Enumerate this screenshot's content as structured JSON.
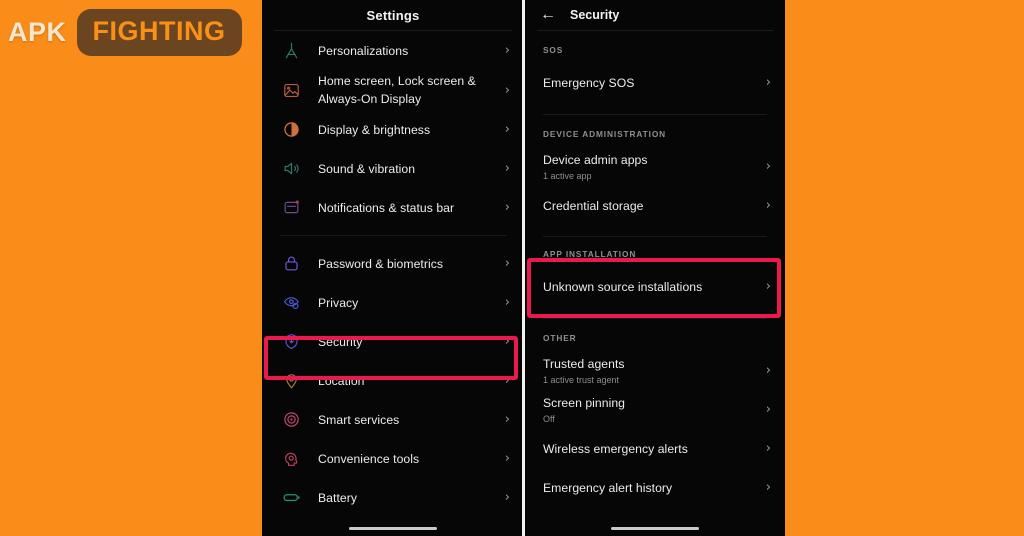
{
  "background_color": "#fa8c19",
  "highlight_color": "#ea1a4f",
  "watermark": {
    "text_primary": "APK",
    "text_badge": "FIGHTING",
    "badge_color": "#6b4420",
    "primary_color": "#f7e7cf",
    "badge_text_color": "#fb9016"
  },
  "left_phone": {
    "header": {
      "title": "Settings"
    },
    "groups": [
      {
        "items": [
          {
            "label": "Personalizations",
            "icon": "compass-icon",
            "icon_color": "#2f7f5e",
            "chevron": "›"
          },
          {
            "label": "Home screen, Lock screen & Always-On Display",
            "icon": "wallpaper-icon",
            "icon_color": "#b85b45",
            "chevron": "›"
          },
          {
            "label": "Display & brightness",
            "icon": "brightness-icon",
            "icon_color": "#d1703f",
            "chevron": "›"
          },
          {
            "label": "Sound & vibration",
            "icon": "speaker-icon",
            "icon_color": "#2f7a6a",
            "chevron": "›"
          },
          {
            "label": "Notifications & status bar",
            "icon": "notification-icon",
            "icon_color": "#6b4d8c",
            "chevron": "›"
          }
        ]
      },
      {
        "items": [
          {
            "label": "Password & biometrics",
            "icon": "lock-icon",
            "icon_color": "#6a58d6",
            "chevron": "›"
          },
          {
            "label": "Privacy",
            "icon": "privacy-eye-icon",
            "icon_color": "#4a5ad8",
            "chevron": "›"
          },
          {
            "label": "Security",
            "icon": "shield-icon",
            "icon_color": "#5a54c9",
            "chevron": "›",
            "highlighted": true
          },
          {
            "label": "Location",
            "icon": "location-pin-icon",
            "icon_color": "#a9793f",
            "chevron": "›"
          },
          {
            "label": "Smart services",
            "icon": "target-icon",
            "icon_color": "#c4436b",
            "chevron": "›"
          },
          {
            "label": "Convenience tools",
            "icon": "head-gear-icon",
            "icon_color": "#c0415a",
            "chevron": "›"
          },
          {
            "label": "Battery",
            "icon": "battery-icon",
            "icon_color": "#2e8f6a",
            "chevron": "›"
          }
        ]
      }
    ]
  },
  "right_phone": {
    "header": {
      "title": "Security",
      "back_icon": "back-arrow-icon"
    },
    "sections": [
      {
        "group_label": "SOS",
        "items": [
          {
            "label": "Emergency SOS",
            "sub": "",
            "chevron": "›"
          }
        ]
      },
      {
        "group_label": "DEVICE ADMINISTRATION",
        "items": [
          {
            "label": "Device admin apps",
            "sub": "1 active app",
            "chevron": "›"
          },
          {
            "label": "Credential storage",
            "sub": "",
            "chevron": "›"
          }
        ]
      },
      {
        "group_label": "APP INSTALLATION",
        "highlighted": true,
        "items": [
          {
            "label": "Unknown source installations",
            "sub": "",
            "chevron": "›"
          }
        ]
      },
      {
        "group_label": "OTHER",
        "items": [
          {
            "label": "Trusted agents",
            "sub": "1 active trust agent",
            "chevron": "›"
          },
          {
            "label": "Screen pinning",
            "sub": "Off",
            "chevron": "›"
          },
          {
            "label": "Wireless emergency alerts",
            "sub": "",
            "chevron": "›"
          },
          {
            "label": "Emergency alert history",
            "sub": "",
            "chevron": "›"
          }
        ]
      }
    ]
  }
}
